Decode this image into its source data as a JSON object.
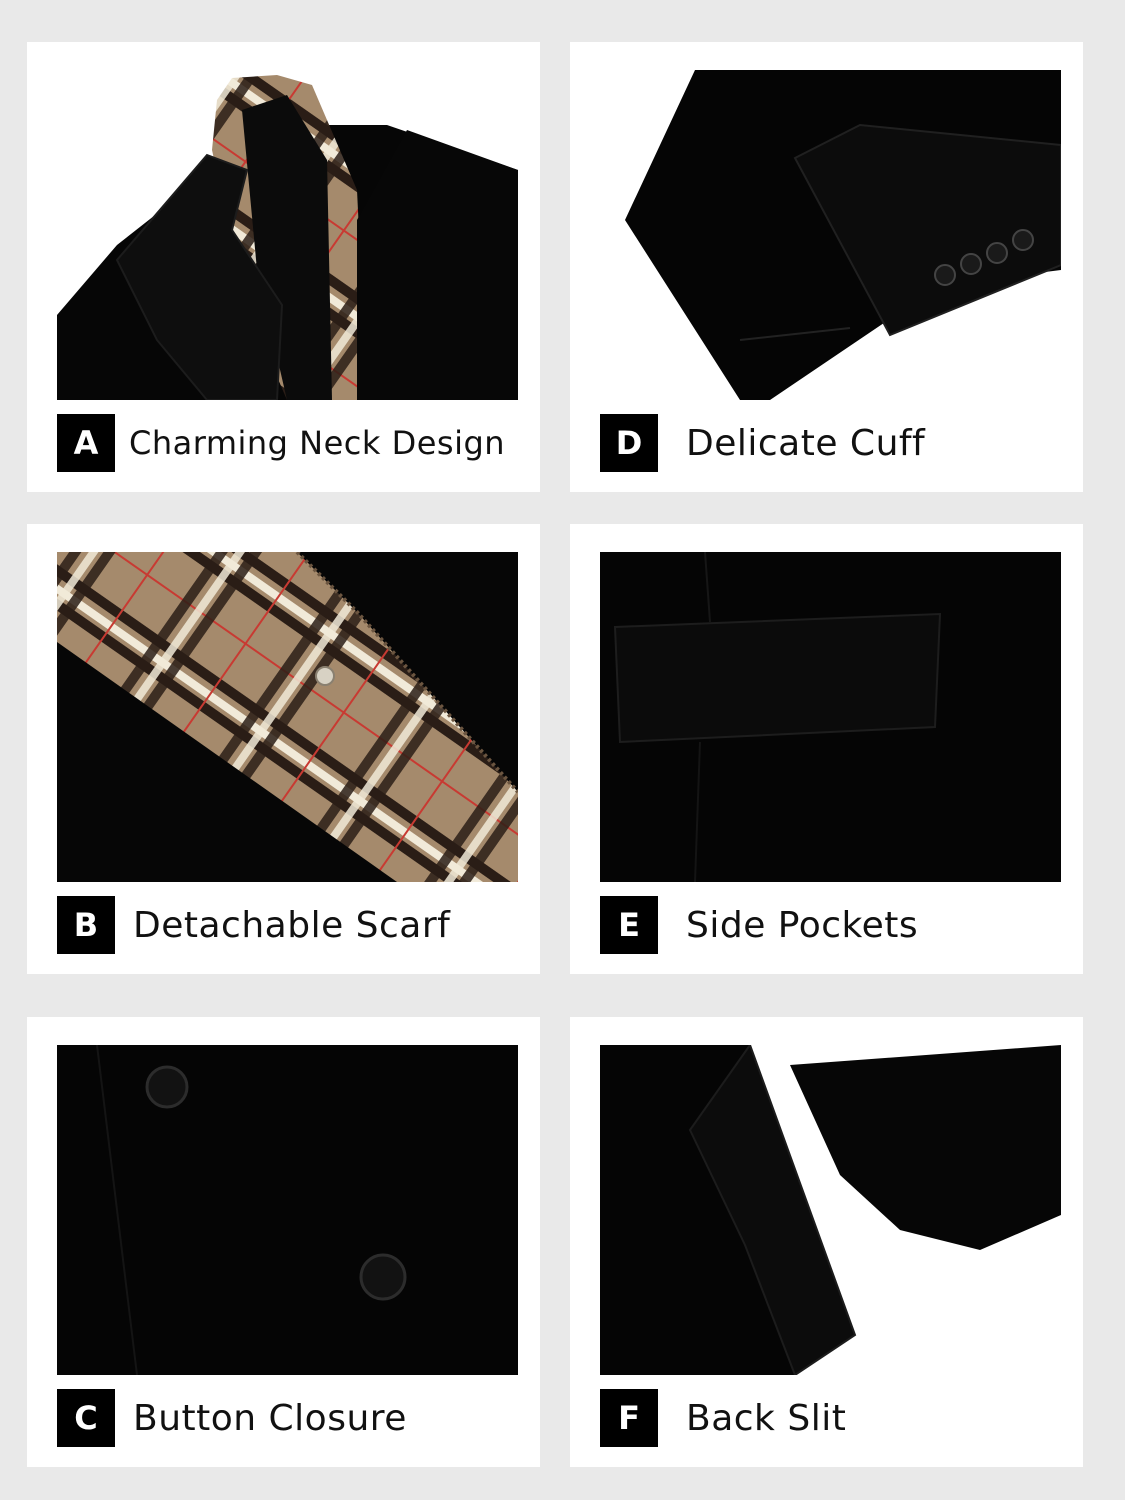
{
  "colors": {
    "background": "#e9e9e9",
    "card": "#ffffff",
    "coat": "#050505",
    "badge": "#000000",
    "plaid_base": "#a58a6c",
    "plaid_dark": "#2a1d16",
    "plaid_cream": "#f1ead9",
    "plaid_red": "#c83a32"
  },
  "features": [
    {
      "letter": "A",
      "title": "Charming Neck Design",
      "image": "plaid-lapel-collar"
    },
    {
      "letter": "D",
      "title": "Delicate Cuff",
      "image": "sleeve-cuff-buttons"
    },
    {
      "letter": "B",
      "title": "Detachable Scarf",
      "image": "plaid-scarf-detail"
    },
    {
      "letter": "E",
      "title": "Side Pockets",
      "image": "flap-pocket"
    },
    {
      "letter": "C",
      "title": "Button Closure",
      "image": "front-buttons"
    },
    {
      "letter": "F",
      "title": "Back Slit",
      "image": "back-vent"
    }
  ]
}
